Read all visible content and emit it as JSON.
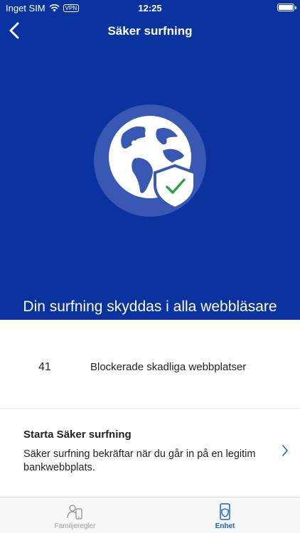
{
  "status_bar": {
    "carrier": "Inget SIM",
    "vpn": "VPN",
    "time": "12:25"
  },
  "nav": {
    "title": "Säker surfning"
  },
  "hero": {
    "headline": "Din surfning skyddas i alla webbläsare"
  },
  "stats": {
    "count": "41",
    "label": "Blockerade skadliga webbplatser"
  },
  "feature": {
    "title": "Starta Säker surfning",
    "description": "Säker surfning bekräftar när du går in på en legitim bankwebbplats."
  },
  "tabs": [
    {
      "label": "Familjeregler",
      "icon": "family-rules-icon",
      "selected": false
    },
    {
      "label": "Enhet",
      "icon": "device-shield-icon",
      "selected": true
    }
  ],
  "colors": {
    "hero_background": "#0a33a0",
    "accent": "#1765c4",
    "check_green": "#2e9e3f"
  }
}
